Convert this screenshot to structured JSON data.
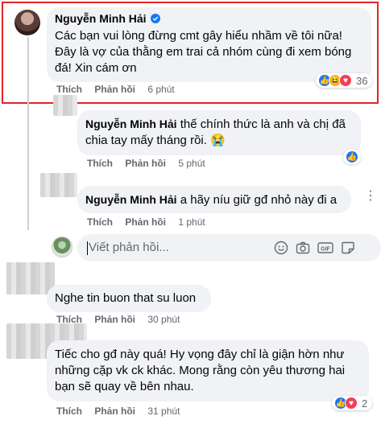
{
  "comments": [
    {
      "author": "Nguyễn Minh Hải",
      "verified": true,
      "text_lines": [
        "Các bạn vui lòng đừng cmt gây hiểu nhầm về tôi nữa!",
        "Đây là vợ của thằng em trai cả nhóm cùng đi xem bóng",
        "đá! Xin cám ơn"
      ],
      "like_label": "Thích",
      "reply_label": "Phản hồi",
      "time": "6 phút",
      "reaction_count": "36",
      "reaction_icons": [
        "like-icon",
        "haha-icon",
        "love-icon"
      ]
    },
    {
      "author": "Nguyễn Minh Hải",
      "text_first": "thế chính thức là anh và chị đã",
      "text_second": "chia tay mấy tháng rồi. 😭",
      "like_label": "Thích",
      "reply_label": "Phản hồi",
      "time": "5 phút",
      "reaction_icons": [
        "like-icon"
      ]
    },
    {
      "author": "Nguyễn Minh Hải",
      "text": "a hãy níu giữ gđ nhỏ này đi a",
      "like_label": "Thích",
      "reply_label": "Phản hồi",
      "time": "1 phút"
    },
    {
      "text": "Nghe tin buon that su luon",
      "like_label": "Thích",
      "reply_label": "Phản hồi",
      "time": "30 phút"
    },
    {
      "text_lines": [
        "Tiếc cho gđ này quá! Hy vọng đây chỉ là giận hờn như",
        "những cặp vk ck khác. Mong rằng còn yêu thương hai",
        "bạn sẽ quay về bên nhau."
      ],
      "like_label": "Thích",
      "reply_label": "Phản hồi",
      "time": "31 phút",
      "reaction_count": "2",
      "reaction_icons": [
        "like-icon",
        "love-icon"
      ]
    }
  ],
  "reply_box": {
    "placeholder": "Viết phản hồi...",
    "tools": [
      "emoji-icon",
      "camera-icon",
      "gif-icon",
      "sticker-icon"
    ]
  },
  "colors": {
    "highlight_border": "#e0252b",
    "like_blue": "#1877f2",
    "love_red": "#f33e58",
    "haha_yellow": "#f7b125"
  }
}
